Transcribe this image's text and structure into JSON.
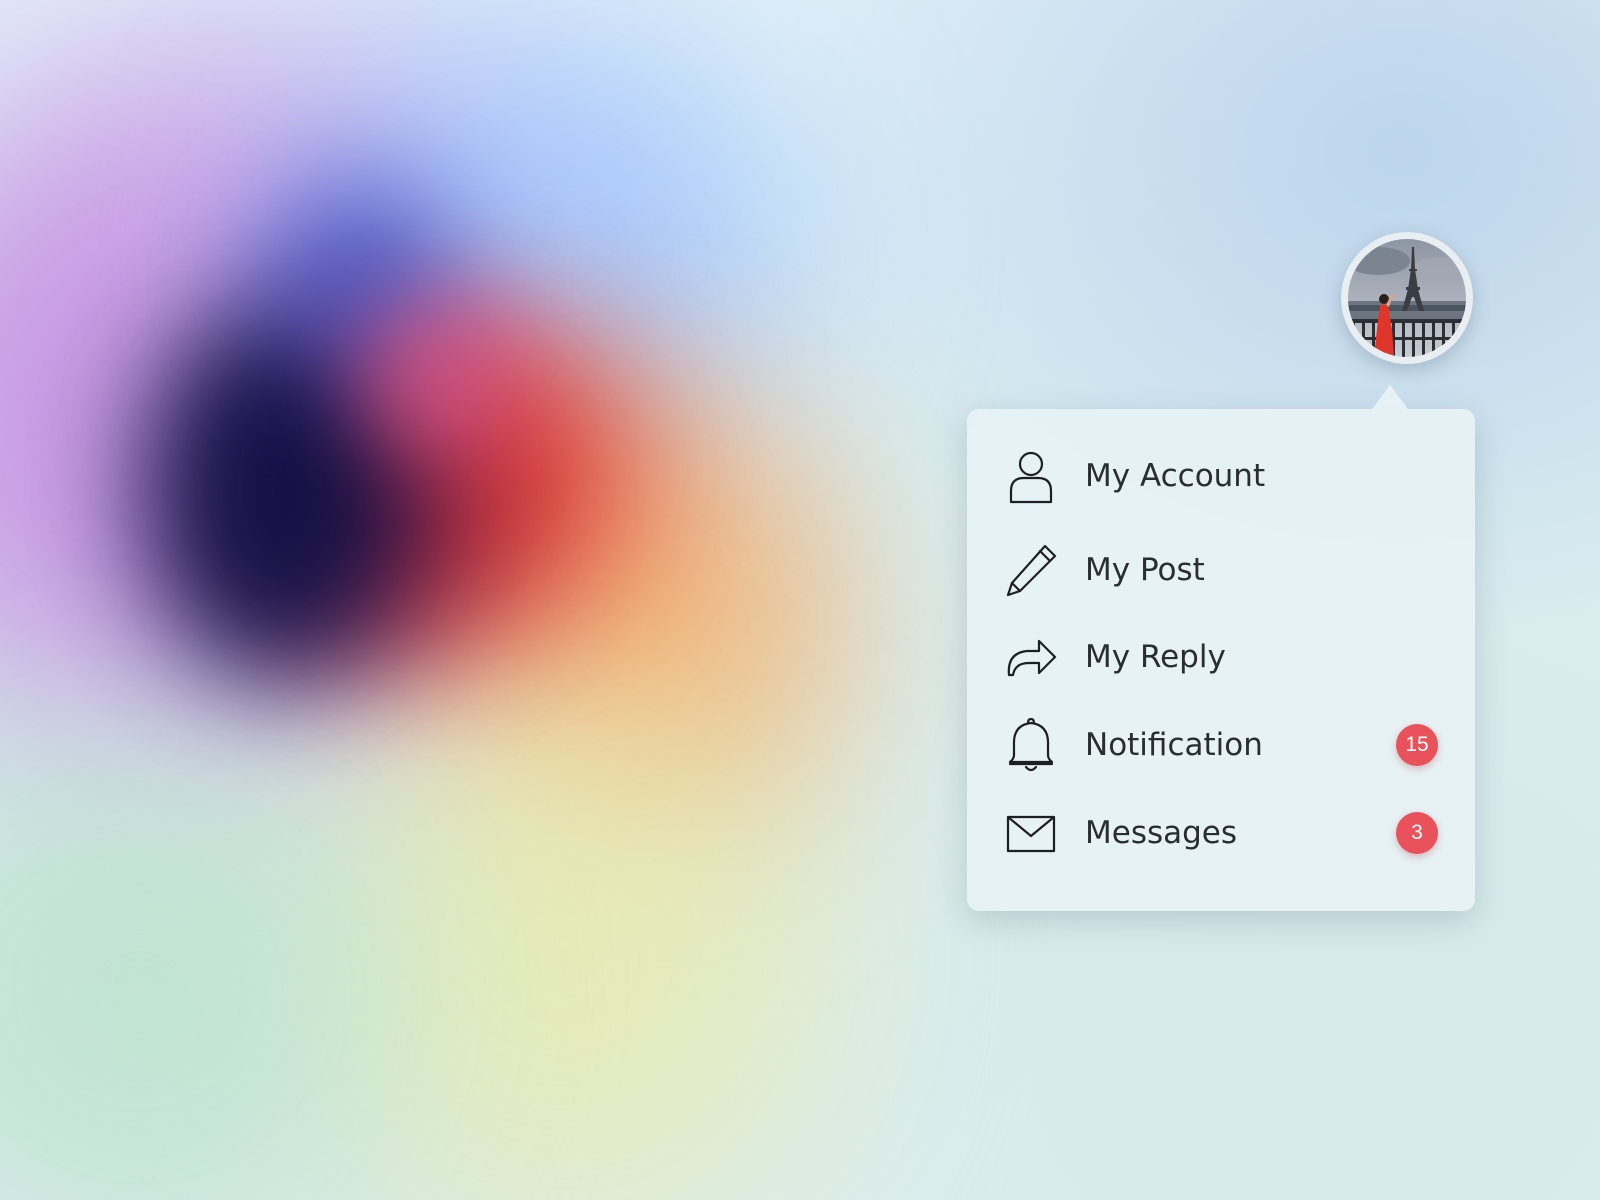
{
  "colors": {
    "badge_background": "#e9525a",
    "menu_text": "#2a2d33",
    "icon_stroke": "#1d1f24"
  },
  "profile": {
    "avatar_icon": "profile-photo-eiffel-tower"
  },
  "menu": {
    "items": [
      {
        "label": "My Account",
        "icon": "user-icon",
        "badge": ""
      },
      {
        "label": "My Post",
        "icon": "pencil-icon",
        "badge": ""
      },
      {
        "label": "My Reply",
        "icon": "reply-arrow-icon",
        "badge": ""
      },
      {
        "label": "Notification",
        "icon": "bell-icon",
        "badge": "15"
      },
      {
        "label": "Messages",
        "icon": "envelope-icon",
        "badge": "3"
      }
    ]
  }
}
